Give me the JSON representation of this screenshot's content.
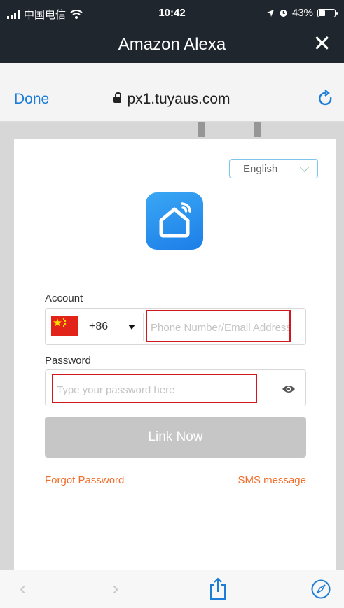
{
  "status_bar": {
    "carrier": "中国电信",
    "time": "10:42",
    "battery": "43%",
    "battery_level": 0.43
  },
  "title_bar": {
    "title": "Amazon Alexa",
    "close_icon": "close-icon"
  },
  "url_bar": {
    "done_label": "Done",
    "url": "px1.tuyaus.com",
    "reload_icon": "reload-icon",
    "lock_icon": "lock-icon"
  },
  "login": {
    "language": "English",
    "account_label": "Account",
    "country_code": "+86",
    "country_flag": "china-flag-icon",
    "account_placeholder": "Phone Number/Email Address",
    "password_label": "Password",
    "password_placeholder": "Type your password here",
    "submit_label": "Link Now",
    "forgot_label": "Forgot Password",
    "sms_label": "SMS message"
  },
  "toolbar": {
    "back": "‹",
    "forward": "›",
    "share_icon": "share-icon",
    "compass_icon": "compass-icon"
  },
  "colors": {
    "accent_blue": "#1c7cd6",
    "link_orange": "#f16d2b",
    "highlight_red": "#d0181d",
    "dark_bar": "#1f262d"
  }
}
